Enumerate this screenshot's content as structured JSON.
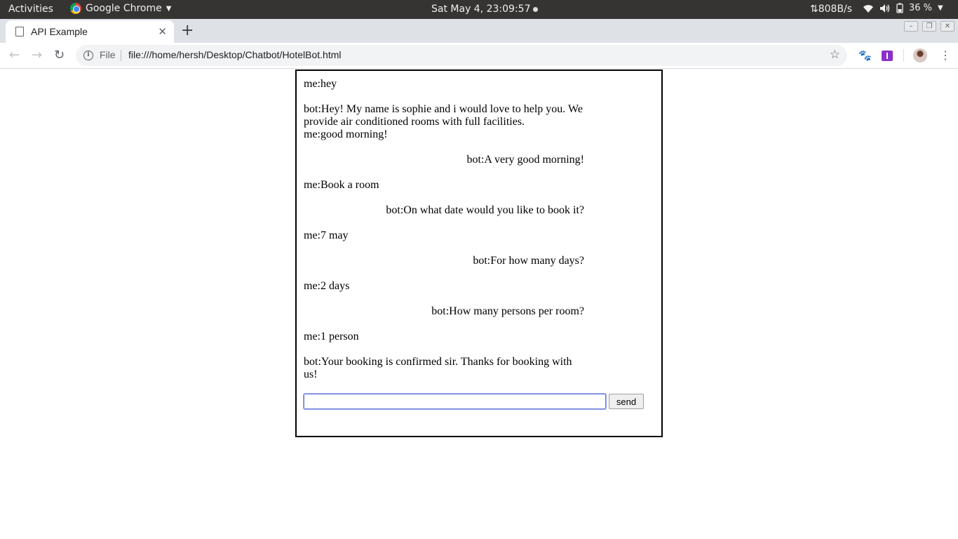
{
  "system_bar": {
    "activities": "Activities",
    "app_name": "Google Chrome",
    "clock": "Sat May  4, 23:09:57",
    "net_speed": "⇅808B/s",
    "battery_percent": "36 %"
  },
  "browser": {
    "tab_title": "API Example",
    "new_tab": "+",
    "file_label": "File",
    "url": "file:///home/hersh/Desktop/Chatbot/HotelBot.html"
  },
  "chat": {
    "messages": [
      {
        "text": "me:hey",
        "align": "left"
      },
      {
        "text": "bot:Hey! My name is sophie and i would love to help you. We provide air conditioned rooms with full facilities.",
        "align": "left"
      },
      {
        "text": "me:good morning!",
        "align": "left"
      },
      {
        "text": "bot:A very good morning!",
        "align": "right"
      },
      {
        "text": "me:Book a room",
        "align": "left"
      },
      {
        "text": "bot:On what date would you like to book it?",
        "align": "right"
      },
      {
        "text": "me:7 may",
        "align": "left"
      },
      {
        "text": "bot:For how many days?",
        "align": "right"
      },
      {
        "text": "me:2 days",
        "align": "left"
      },
      {
        "text": "bot:How many persons per room?",
        "align": "right"
      },
      {
        "text": "me:1 person",
        "align": "left"
      },
      {
        "text": "bot:Your booking is confirmed sir. Thanks for booking with us!",
        "align": "left"
      }
    ],
    "input_value": "",
    "send_label": "send"
  },
  "colors": {
    "system_bar_bg": "#353432",
    "tab_strip_bg": "#dee1e6",
    "omnibox_bg": "#f1f3f4",
    "input_focus_border": "#6c7bd6"
  }
}
